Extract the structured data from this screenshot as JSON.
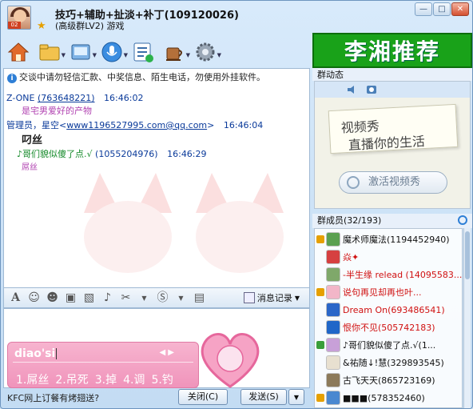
{
  "window": {
    "title": "技巧+辅助+扯淡+补丁(109120026)",
    "subtitle": "(高级群LV2) 游戏",
    "buttons": {
      "min": "—",
      "max": "□",
      "close": "✕"
    }
  },
  "toolbar": {
    "items": [
      "home-icon",
      "folder-icon",
      "share-icon",
      "microphone-icon",
      "list-icon",
      "coffee-icon",
      "gear-icon"
    ]
  },
  "banner": {
    "text": "李湘推荐"
  },
  "chat": {
    "notice": "交谈中请勿轻信汇款、中奖信息、陌生电话，勿使用外挂软件。",
    "messages": [
      {
        "sender": "Z-ONE",
        "qq": "(763648221)",
        "time": "16:46:02",
        "text": "是宅男爱好的产物"
      },
      {
        "sender": "管理员，星空<",
        "email": "www1196527995.com@qq.com",
        "suffix": ">",
        "time": "16:46:04",
        "text": "叼丝"
      },
      {
        "sender": "♪哥们貌似傻了点.√",
        "qq": "(1055204976)",
        "time": "16:46:29",
        "text": "屌丝"
      }
    ]
  },
  "format_bar": {
    "record_label": "消息记录"
  },
  "ime": {
    "input": "diao'si",
    "candidates": [
      "1.屌丝",
      "2.吊死",
      "3.掉",
      "4.调",
      "5.钓"
    ]
  },
  "bottom": {
    "ad_text": "KFC网上订餐有烤翅送?",
    "close_label": "关闭(C)",
    "send_label": "发送(S)"
  },
  "right": {
    "group_dynamic_label": "群动态",
    "video_line1": "视频秀",
    "video_line2": "直播你的生活",
    "activate_label": "激活视频秀",
    "members_label": "群成员(32/193)",
    "members": [
      {
        "name": "魔术师魔法(1194452940)",
        "color": "#111111"
      },
      {
        "name": "焱✦",
        "color": "#d01010"
      },
      {
        "name": "-半生缘 relead (14095583...",
        "color": "#d01010"
      },
      {
        "name": "说句再见却再也叶...",
        "color": "#d01010"
      },
      {
        "name": "Dream On(693486541)",
        "color": "#d01010"
      },
      {
        "name": "恨你不见(505742183)",
        "color": "#d01010"
      },
      {
        "name": "♪哥们貌似傻了点.√(1...",
        "color": "#111111"
      },
      {
        "name": "&祐随↓!慧(329893545)",
        "color": "#111111"
      },
      {
        "name": "古飞天天(865723169)",
        "color": "#111111"
      },
      {
        "name": "■■■(578352460)",
        "color": "#111111"
      }
    ]
  }
}
